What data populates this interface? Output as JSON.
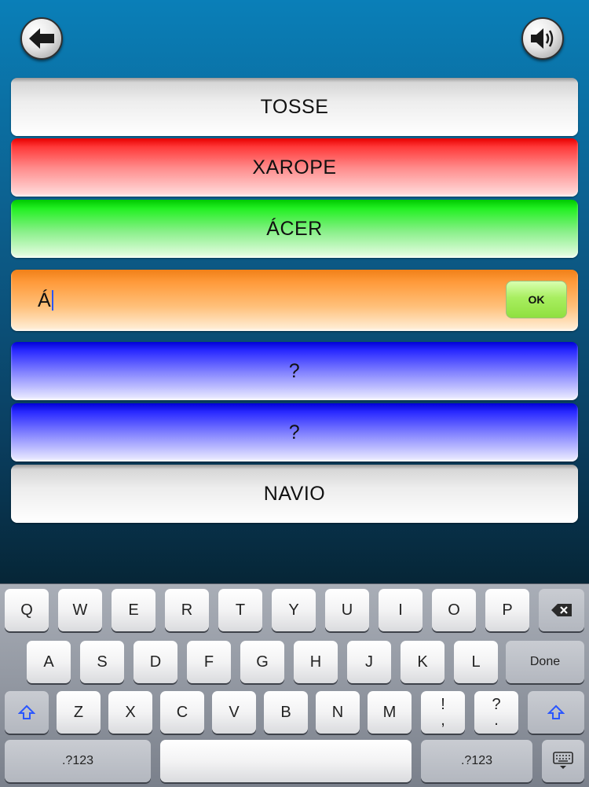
{
  "header": {
    "back_icon": "back-arrow-icon",
    "sound_icon": "speaker-icon"
  },
  "rows": [
    {
      "label": "TOSSE",
      "color": "#ededed"
    },
    {
      "label": "XAROPE",
      "color": "#ff3a3a"
    },
    {
      "label": "ÁCER",
      "color": "#22f022"
    },
    {
      "input_value": "Á",
      "ok_label": "OK",
      "color": "#ff9a3a"
    },
    {
      "label": "?",
      "color": "#2a2aff"
    },
    {
      "label": "?",
      "color": "#2a2aff"
    },
    {
      "label": "NAVIO",
      "color": "#ededed"
    }
  ],
  "keyboard": {
    "row1": [
      "Q",
      "W",
      "E",
      "R",
      "T",
      "Y",
      "U",
      "I",
      "O",
      "P"
    ],
    "row2": [
      "A",
      "S",
      "D",
      "F",
      "G",
      "H",
      "J",
      "K",
      "L"
    ],
    "done": "Done",
    "row3": [
      "Z",
      "X",
      "C",
      "V",
      "B",
      "N",
      "M"
    ],
    "exclam_top": "!",
    "exclam_bottom": ",",
    "question_top": "?",
    "question_bottom": ".",
    "numbers_label": ".?123",
    "delete_icon": "backspace-icon",
    "shift_icon": "shift-icon",
    "hide_icon": "keyboard-hide-icon"
  }
}
